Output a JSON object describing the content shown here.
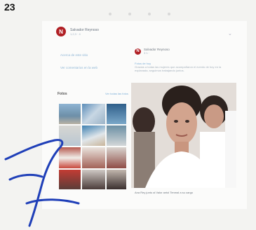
{
  "page": {
    "number": "23"
  },
  "profile": {
    "name": "Salvador Reynoso",
    "subtitle": "1,2,3 · 4"
  },
  "left_links": [
    "Acerca de este sitio",
    "Ver comentarios en la web"
  ],
  "post": {
    "author": "Salvador Reynoso",
    "meta": "3 h ·",
    "headline": "Fotos de hoy",
    "text": "Gracias a todas las mujeres que acompañaron el evento de hoy en la explanada, seguimos trabajando juntos.",
    "caption": "Ana Rey junto al Valor antol Tenmal a su cargo"
  },
  "photos_section": {
    "title": "Fotos",
    "link": "Ver todas las fotos"
  },
  "colors": {
    "brand": "#b01f24",
    "ink_mark": "#1f3fb8"
  }
}
